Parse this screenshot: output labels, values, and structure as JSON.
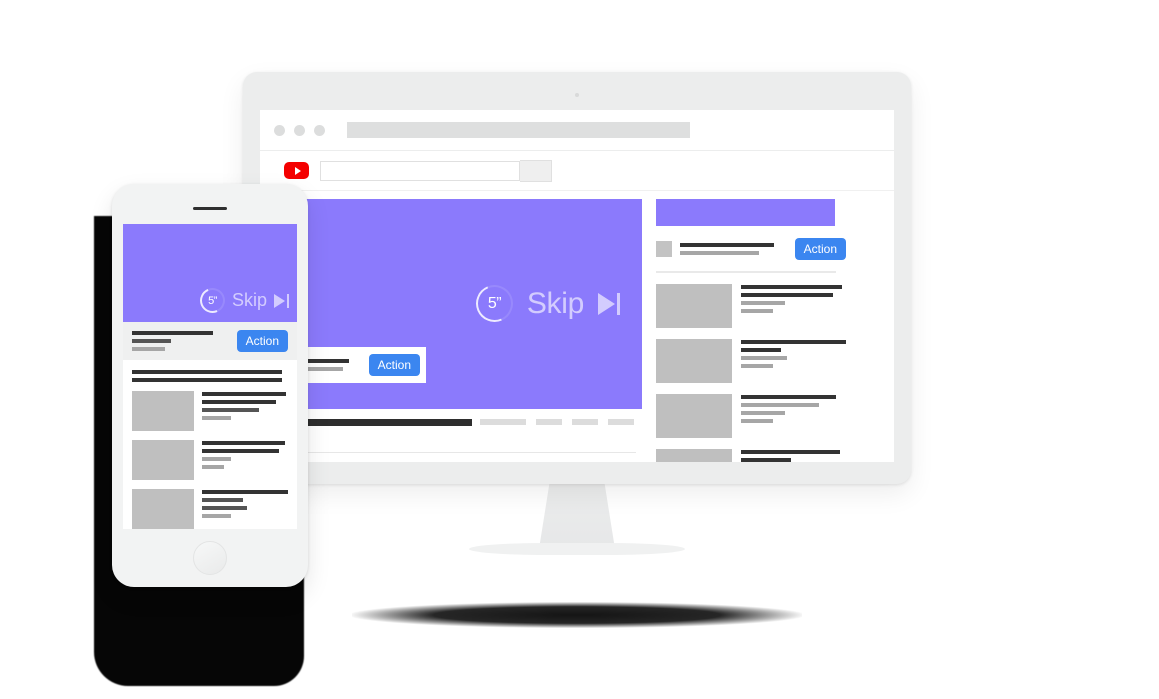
{
  "meta": {
    "concept": "YouTube skippable video ad (TrueView) mockup on desktop monitor and mobile phone",
    "colors": {
      "ad_purple": "#8b7afc",
      "action_blue": "#3b86f0",
      "youtube_red": "#f40000",
      "device_gray": "#eceded",
      "thumbnail_gray": "#bfbfbf",
      "page_background": "#ffffff"
    }
  },
  "desktop": {
    "device": "imac-style-monitor",
    "browser": {
      "traffic_lights": [
        "close-dot",
        "minimize-dot",
        "maximize-dot"
      ],
      "url_bar_value": "",
      "url_bar_placeholder": ""
    },
    "youtube_bar": {
      "logo_label": "YouTube",
      "search_value": "",
      "search_placeholder": "",
      "search_button_label": ""
    },
    "player": {
      "countdown": "5”",
      "skip_label": "Skip",
      "skip_icon": "skip-forward-icon",
      "overlay_ad": {
        "action_label": "Action",
        "line_widths": [
          "78%",
          "66%"
        ]
      }
    },
    "under_video": {
      "title_placeholder": "",
      "meta_placeholder": "",
      "chips": [
        "",
        "",
        "",
        ""
      ]
    },
    "sidebar": {
      "banner_label": "",
      "companion_ad": {
        "action_label": "Action",
        "line_widths": [
          "88%",
          "74%"
        ]
      },
      "items": [
        {
          "line_widths": [
            "96%",
            "88%",
            "42%",
            "30%"
          ]
        },
        {
          "line_widths": [
            "100%",
            "38%",
            "44%",
            "30%"
          ]
        },
        {
          "line_widths": [
            "90%",
            "74%",
            "42%",
            "30%"
          ]
        },
        {
          "line_widths": [
            "94%",
            "48%",
            "40%",
            "28%"
          ]
        }
      ]
    }
  },
  "mobile": {
    "device": "iphone-style-phone",
    "player": {
      "countdown": "5”",
      "skip_label": "Skip",
      "skip_icon": "skip-forward-icon"
    },
    "ad_row": {
      "action_label": "Action",
      "line_widths": [
        "84%",
        "40%",
        "34%"
      ]
    },
    "title_block": {
      "line_widths": [
        "96%",
        "96%"
      ]
    },
    "items": [
      {
        "line_widths": [
          "98%",
          "86%",
          "66%",
          "34%"
        ]
      },
      {
        "line_widths": [
          "96%",
          "90%",
          "34%",
          "26%"
        ]
      },
      {
        "line_widths": [
          "100%",
          "48%",
          "52%",
          "34%"
        ]
      }
    ]
  }
}
